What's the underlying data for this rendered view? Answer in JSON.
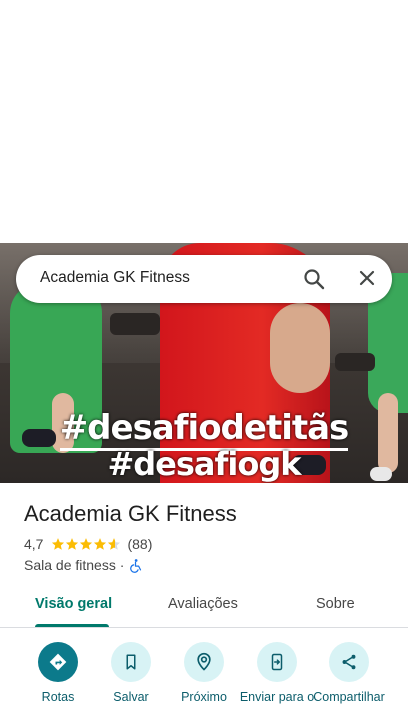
{
  "search": {
    "query": "Academia GK Fitness"
  },
  "photo": {
    "hashtag_line1": "#desafiodetitãs",
    "hashtag_line2": "#desafiogk"
  },
  "place": {
    "name": "Academia GK Fitness",
    "rating": "4,7",
    "stars": 4.7,
    "review_count": "(88)",
    "category": "Sala de fitness ·"
  },
  "tabs": [
    {
      "label": "Visão geral",
      "active": true
    },
    {
      "label": "Avaliações",
      "active": false
    },
    {
      "label": "Sobre",
      "active": false
    }
  ],
  "actions": [
    {
      "label": "Rotas",
      "icon": "directions-icon"
    },
    {
      "label": "Salvar",
      "icon": "bookmark-icon"
    },
    {
      "label": "Próximo",
      "icon": "nearby-icon"
    },
    {
      "label": "Enviar para o",
      "icon": "send-to-phone-icon"
    },
    {
      "label": "Compartilhar",
      "icon": "share-icon"
    }
  ],
  "colors": {
    "accent": "#00796b",
    "action_primary": "#0c7a8b",
    "action_bg": "#d8f3f5",
    "star": "#fbbc04"
  }
}
